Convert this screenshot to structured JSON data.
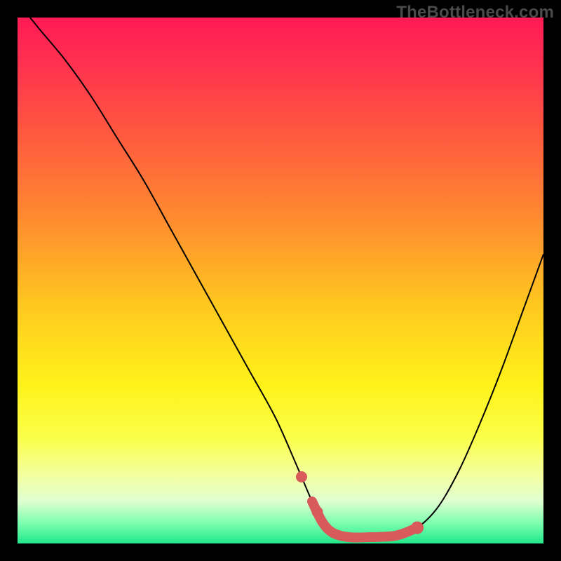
{
  "watermark": "TheBottleneck.com",
  "colors": {
    "curve": "#000000",
    "highlight": "#d85a5a"
  },
  "chart_data": {
    "type": "line",
    "title": "",
    "xlabel": "",
    "ylabel": "",
    "xlim": [
      0,
      100
    ],
    "ylim": [
      0,
      100
    ],
    "grid": false,
    "legend": false,
    "series": [
      {
        "name": "bottleneck-curve",
        "x": [
          0,
          4,
          9,
          14,
          19,
          24,
          29,
          34,
          39,
          44,
          49,
          53,
          56,
          58,
          60,
          63,
          67,
          72,
          76,
          80,
          84,
          88,
          92,
          96,
          100
        ],
        "y": [
          103,
          98,
          92,
          85,
          77,
          69,
          60,
          51,
          42,
          33,
          24,
          15,
          8,
          4,
          2,
          1.2,
          1.2,
          1.5,
          3,
          7,
          14,
          23,
          33,
          44,
          55
        ]
      }
    ],
    "highlight_flat_range_x": [
      56,
      76
    ],
    "annotations": []
  }
}
